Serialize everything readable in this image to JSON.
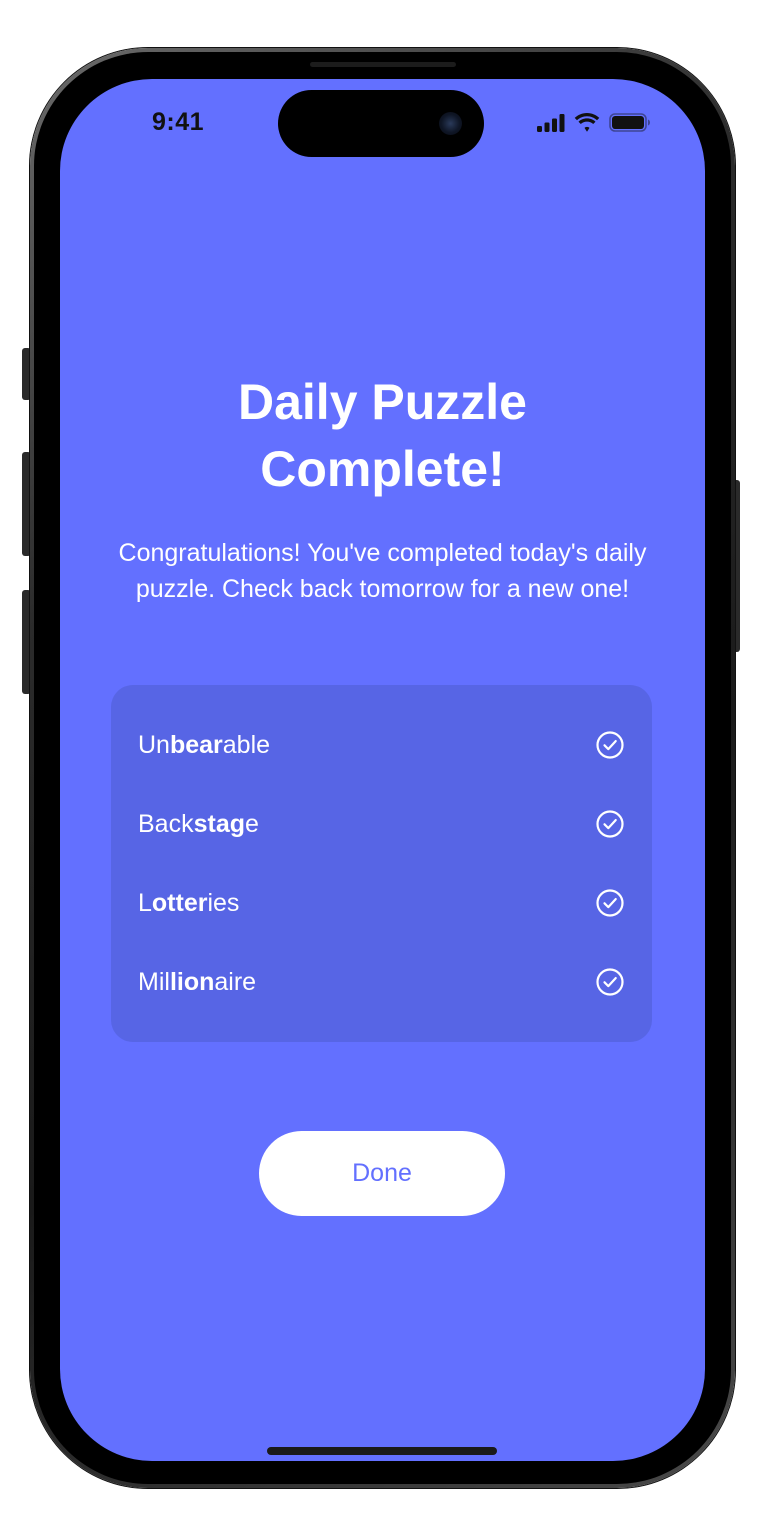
{
  "status_bar": {
    "time": "9:41",
    "signal_icon": "cellular-signal-icon",
    "wifi_icon": "wifi-icon",
    "battery_icon": "battery-icon"
  },
  "main": {
    "title_line1": "Daily Puzzle",
    "title_line2": "Complete!",
    "message": "Congratulations! You've completed today's daily puzzle. Check back tomorrow for a new one!"
  },
  "words": [
    {
      "pre": "Un",
      "bold": "bear",
      "post": "able",
      "status_icon": "check-circle-icon"
    },
    {
      "pre": "Back",
      "bold": "stag",
      "post": "e",
      "status_icon": "check-circle-icon"
    },
    {
      "pre": "L",
      "bold": "otter",
      "post": "ies",
      "status_icon": "check-circle-icon"
    },
    {
      "pre": "Mil",
      "bold": "lion",
      "post": "aire",
      "status_icon": "check-circle-icon"
    }
  ],
  "actions": {
    "done_label": "Done"
  },
  "colors": {
    "screen_background": "#6370FF",
    "card_background": "#5765E5",
    "button_background": "#FFFFFF",
    "button_text": "#6370FF",
    "text": "#FFFFFF"
  }
}
